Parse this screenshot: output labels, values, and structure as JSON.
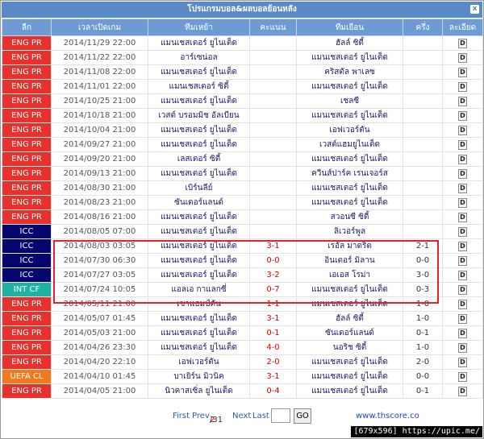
{
  "header": {
    "title": "โปรแกรมบอล&ผลบอลย้อนหลัง",
    "close_label": "x"
  },
  "columns": [
    "ลีก",
    "เวลาเปิดเกม",
    "ทีมเหย้า",
    "คะแนน",
    "ทีมเยือน",
    "ครึ่ง",
    "ละเอียด"
  ],
  "detail_label": "D",
  "league_colors": {
    "ENG PR": "#e8302c",
    "ICC": "#06066e",
    "INT CF": "#1fb2a4",
    "UEFA CL": "#f07a1c"
  },
  "rows": [
    {
      "league": "ENG PR",
      "time": "2014/11/29 22:00",
      "home": "แมนเชสเตอร์ ยูไนเต็ด",
      "score": "",
      "away": "ฮัลล์ ซิตี้",
      "half": ""
    },
    {
      "league": "ENG PR",
      "time": "2014/11/22 22:00",
      "home": "อาร์เซน่อล",
      "score": "",
      "away": "แมนเชสเตอร์ ยูไนเต็ด",
      "half": ""
    },
    {
      "league": "ENG PR",
      "time": "2014/11/08 22:00",
      "home": "แมนเชสเตอร์ ยูไนเต็ด",
      "score": "",
      "away": "คริสตัล พาเลซ",
      "half": ""
    },
    {
      "league": "ENG PR",
      "time": "2014/11/01 22:00",
      "home": "แมนเชสเตอร์ ซิตี้",
      "score": "",
      "away": "แมนเชสเตอร์ ยูไนเต็ด",
      "half": ""
    },
    {
      "league": "ENG PR",
      "time": "2014/10/25 21:00",
      "home": "แมนเชสเตอร์ ยูไนเต็ด",
      "score": "",
      "away": "เชลซี",
      "half": ""
    },
    {
      "league": "ENG PR",
      "time": "2014/10/18 21:00",
      "home": "เวสต์ บรอมมิช อัลเบียน",
      "score": "",
      "away": "แมนเชสเตอร์ ยูไนเต็ด",
      "half": ""
    },
    {
      "league": "ENG PR",
      "time": "2014/10/04 21:00",
      "home": "แมนเชสเตอร์ ยูไนเต็ด",
      "score": "",
      "away": "เอฟเวอร์ตัน",
      "half": ""
    },
    {
      "league": "ENG PR",
      "time": "2014/09/27 21:00",
      "home": "แมนเชสเตอร์ ยูไนเต็ด",
      "score": "",
      "away": "เวสต์แฮมยูไนเต็ด",
      "half": ""
    },
    {
      "league": "ENG PR",
      "time": "2014/09/20 21:00",
      "home": "เลสเตอร์ ซิตี้",
      "score": "",
      "away": "แมนเชสเตอร์ ยูไนเต็ด",
      "half": ""
    },
    {
      "league": "ENG PR",
      "time": "2014/09/13 21:00",
      "home": "แมนเชสเตอร์ ยูไนเต็ด",
      "score": "",
      "away": "ควีนส์ปาร์ค เรนเจอร์ส",
      "half": ""
    },
    {
      "league": "ENG PR",
      "time": "2014/08/30 21:00",
      "home": "เบิร์นลีย์",
      "score": "",
      "away": "แมนเชสเตอร์ ยูไนเต็ด",
      "half": ""
    },
    {
      "league": "ENG PR",
      "time": "2014/08/23 21:00",
      "home": "ซันเดอร์แลนด์",
      "score": "",
      "away": "แมนเชสเตอร์ ยูไนเต็ด",
      "half": ""
    },
    {
      "league": "ENG PR",
      "time": "2014/08/16 21:00",
      "home": "แมนเชสเตอร์ ยูไนเต็ด",
      "score": "",
      "away": "สวอนซี ซิตี้",
      "half": ""
    },
    {
      "league": "ICC",
      "time": "2014/08/05 07:00",
      "home": "แมนเชสเตอร์ ยูไนเต็ด",
      "score": "",
      "away": "ลิเวอร์พูล",
      "half": ""
    },
    {
      "league": "ICC",
      "time": "2014/08/03 03:05",
      "home": "แมนเชสเตอร์ ยูไนเต็ด",
      "score": "3-1",
      "away": "เรอัล มาดริด",
      "half": "2-1"
    },
    {
      "league": "ICC",
      "time": "2014/07/30 06:30",
      "home": "แมนเชสเตอร์ ยูไนเต็ด",
      "score": "0-0",
      "away": "อินเตอร์ มิลาน",
      "half": "0-0"
    },
    {
      "league": "ICC",
      "time": "2014/07/27 03:05",
      "home": "แมนเชสเตอร์ ยูไนเต็ด",
      "score": "3-2",
      "away": "เอเอส โรม่า",
      "half": "3-0"
    },
    {
      "league": "INT CF",
      "time": "2014/07/24 10:05",
      "home": "แอลเอ กาแลกซี่",
      "score": "0-7",
      "away": "แมนเชสเตอร์ ยูไนเต็ด",
      "half": "0-3"
    },
    {
      "league": "ENG PR",
      "time": "2014/05/11 21:00",
      "home": "เซาแธมป์ตัน",
      "score": "1-1",
      "away": "แมนเชสเตอร์ ยูไนเต็ด",
      "half": "1-0"
    },
    {
      "league": "ENG PR",
      "time": "2014/05/07 01:45",
      "home": "แมนเชสเตอร์ ยูไนเต็ด",
      "score": "3-1",
      "away": "ฮัลล์ ซิตี้",
      "half": "1-0"
    },
    {
      "league": "ENG PR",
      "time": "2014/05/03 21:00",
      "home": "แมนเชสเตอร์ ยูไนเต็ด",
      "score": "0-1",
      "away": "ซันเดอร์แลนด์",
      "half": "0-1"
    },
    {
      "league": "ENG PR",
      "time": "2014/04/26 23:30",
      "home": "แมนเชสเตอร์ ยูไนเต็ด",
      "score": "4-0",
      "away": "นอริช ซิตี้",
      "half": "1-0"
    },
    {
      "league": "ENG PR",
      "time": "2014/04/20 22:10",
      "home": "เอฟเวอร์ตัน",
      "score": "2-0",
      "away": "แมนเชสเตอร์ ยูไนเต็ด",
      "half": "2-0"
    },
    {
      "league": "UEFA CL",
      "time": "2014/04/10 01:45",
      "home": "บาเยิร์น มิวนิค",
      "score": "3-1",
      "away": "แมนเชสเตอร์ ยูไนเต็ด",
      "half": "0-0"
    },
    {
      "league": "ENG PR",
      "time": "2014/04/05 21:00",
      "home": "นิวคาสเซิ่ล ยูไนเต็ด",
      "score": "0-4",
      "away": "แมนเชสเตอร์ ยูไนเต็ด",
      "half": "0-1"
    }
  ],
  "pager": {
    "first": "First",
    "prev": "Prev",
    "current": "2",
    "total": "/31",
    "next": "Next",
    "last": "Last",
    "input_value": "",
    "go": "GO"
  },
  "site": "www.thscore.co",
  "watermark": "[679x596] https://upic.me/"
}
